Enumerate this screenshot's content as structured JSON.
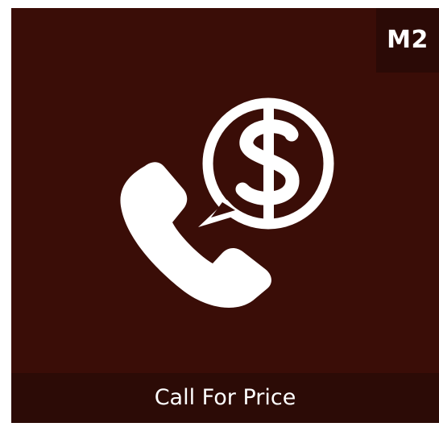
{
  "badge": {
    "label": "M2"
  },
  "emblem": {
    "icon_name": "call-for-price-icon",
    "parts": [
      "phone-handset-icon",
      "speech-bubble-icon",
      "dollar-sign-icon"
    ],
    "icon_color": "#ffffff",
    "background_color": "#3a0d07"
  },
  "footer": {
    "title": "Call For Price",
    "background_color": "#2c0b06"
  }
}
